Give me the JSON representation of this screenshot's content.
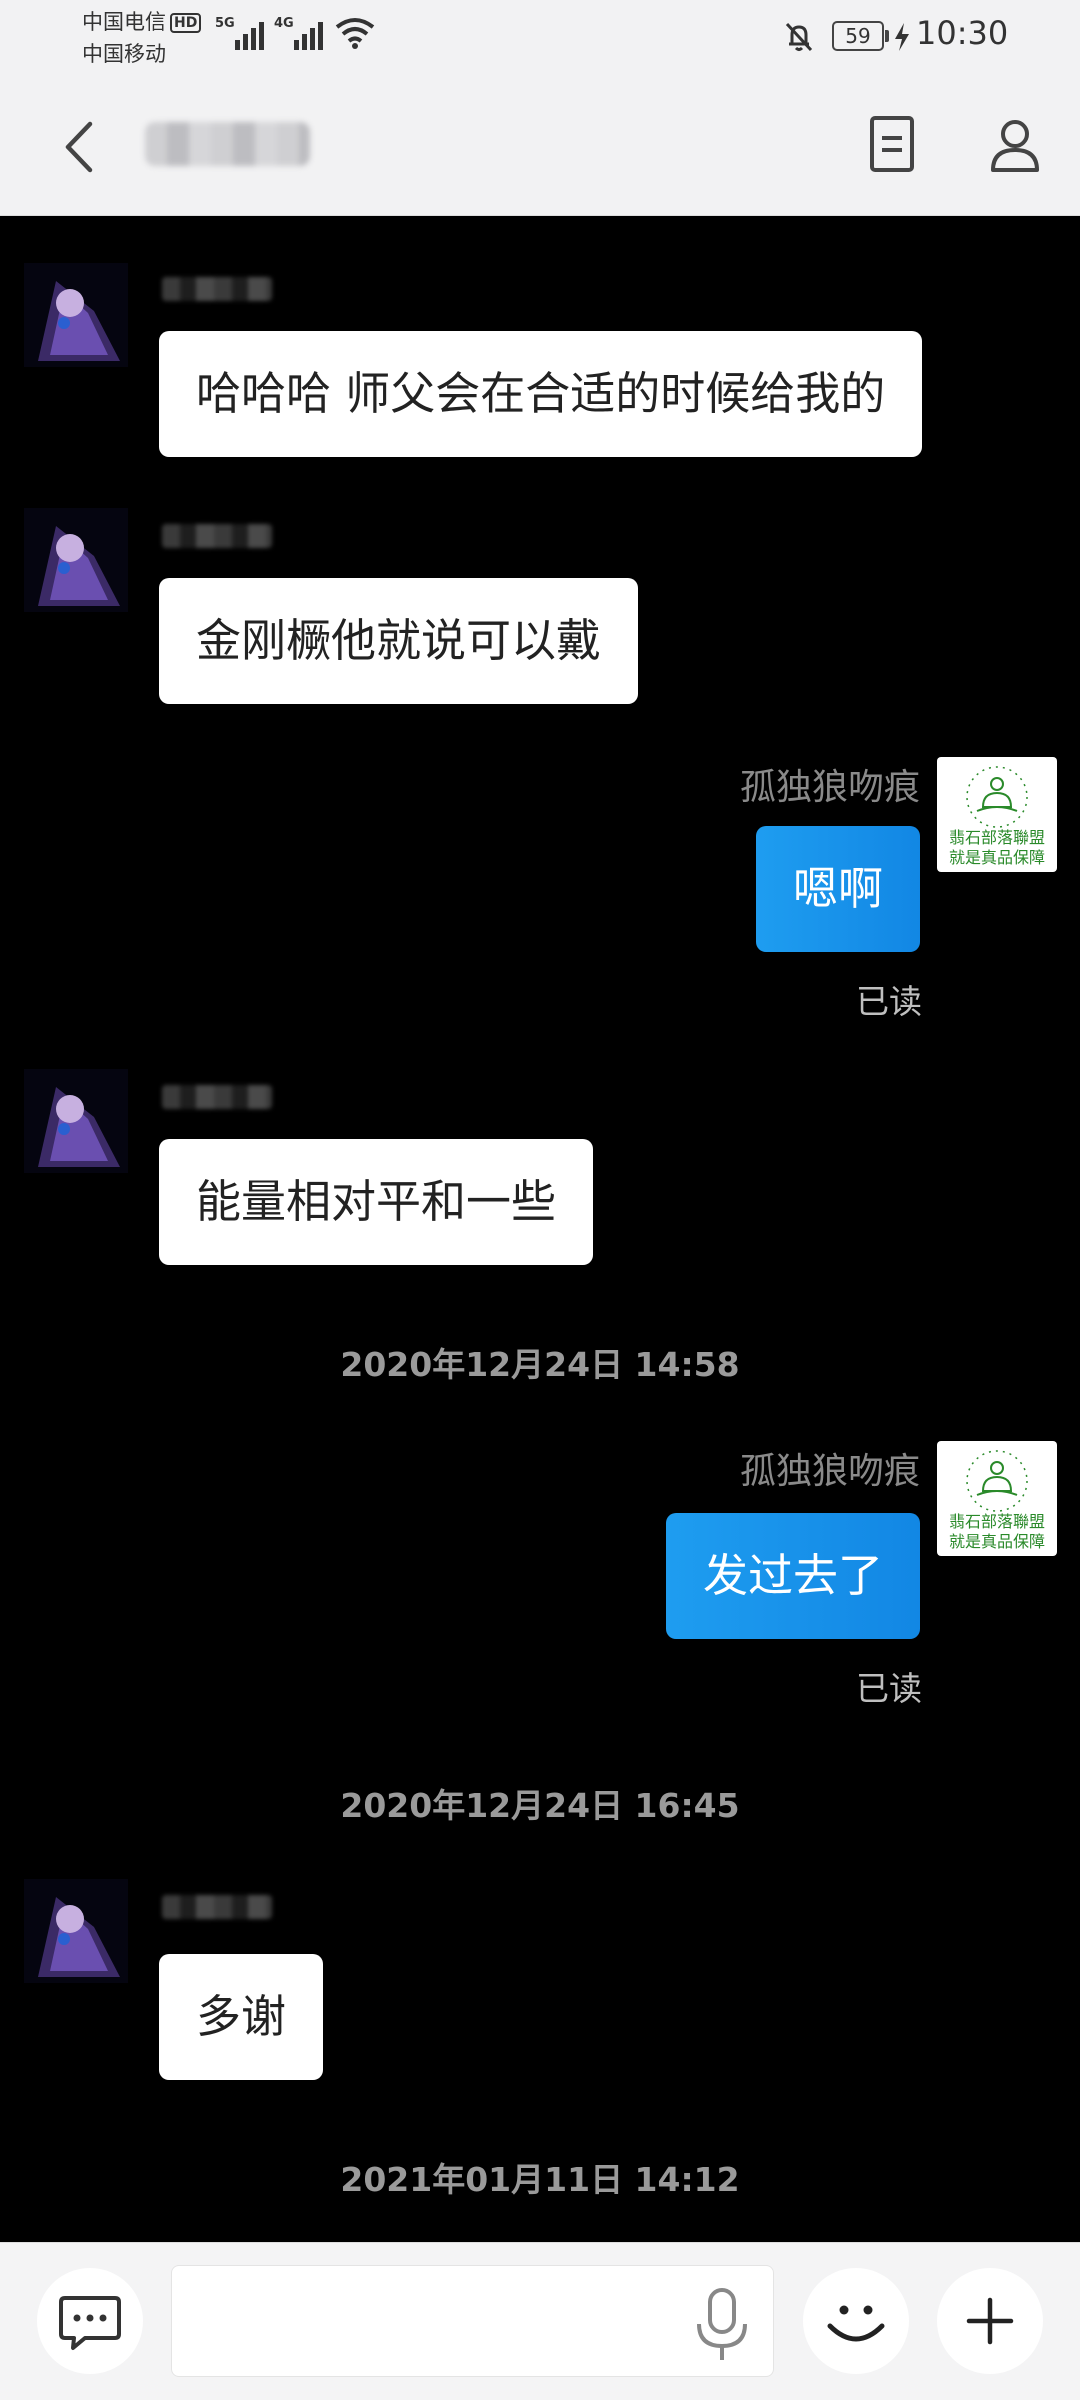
{
  "status_bar": {
    "carrier_1": "中国电信",
    "hd_badge": "HD",
    "carrier_2": "中国移动",
    "network_1": "5G",
    "network_2": "4G",
    "battery": "59",
    "time": "10:30"
  },
  "messages": [
    {
      "dir": "in",
      "text": "哈哈哈 师父会在合适的时候给我的"
    },
    {
      "dir": "in",
      "text": "金刚橛他就说可以戴"
    },
    {
      "dir": "out",
      "sender": "孤独狼吻痕",
      "text": "嗯啊",
      "status": "已读"
    },
    {
      "dir": "in",
      "text": "能量相对平和一些"
    },
    {
      "timestamp": "2020年12月24日 14:58"
    },
    {
      "dir": "out",
      "sender": "孤独狼吻痕",
      "text": "发过去了",
      "status": "已读"
    },
    {
      "timestamp": "2020年12月24日 16:45"
    },
    {
      "dir": "in",
      "text": "多谢"
    },
    {
      "timestamp": "2021年01月11日 14:12"
    }
  ],
  "my_avatar_text": [
    "翡石部落聯盟",
    "就是真品保障"
  ],
  "colors": {
    "bubble_out": "#1a95ec",
    "bubble_in": "#ffffff",
    "background": "#000000",
    "bar": "#f2f2f3"
  },
  "icons": {
    "back": "chevron-left-icon",
    "doc": "document-icon",
    "profile": "person-icon",
    "chat": "chat-bubble-icon",
    "voice": "microphone-icon",
    "emoji": "smiley-icon",
    "more": "plus-icon"
  }
}
